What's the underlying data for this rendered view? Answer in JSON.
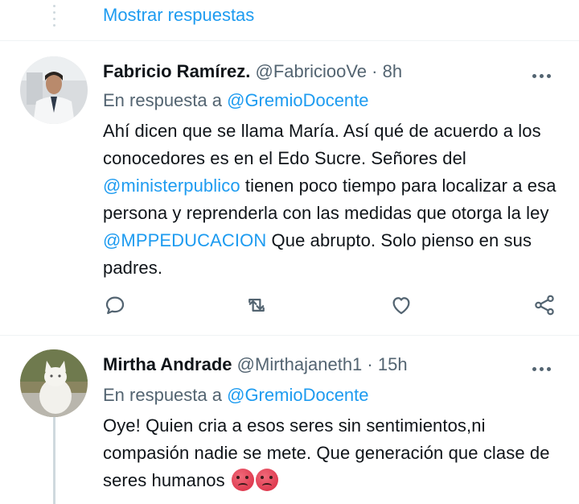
{
  "show_replies": {
    "label": "Mostrar respuestas"
  },
  "tweets": [
    {
      "name": "Fabricio Ramírez.",
      "handle": "@FabricioоVe",
      "separator": "·",
      "time": "8h",
      "reply_prefix": "En respuesta a",
      "reply_mention": "@GremioDocente",
      "body": [
        {
          "t": "Ahí dicen que se llama María. Así qué de acuerdo a los conocedores es en el Edo Sucre. Señores del "
        },
        {
          "t": "@ministerpublico",
          "mention": true
        },
        {
          "t": " tienen poco tiempo para localizar a esa persona y reprenderla con las medidas que otorga la ley "
        },
        {
          "t": "@MPPEDUCACION",
          "mention": true
        },
        {
          "t": " Que abrupto. Solo pienso en sus padres."
        }
      ],
      "icons": [
        "reply-icon",
        "retweet-icon",
        "like-icon",
        "share-icon"
      ]
    },
    {
      "name": "Mirtha Andrade",
      "handle": "@Mirthajaneth1",
      "separator": "·",
      "time": "15h",
      "reply_prefix": "En respuesta a",
      "reply_mention": "@GremioDocente",
      "body": [
        {
          "t": "Oye! Quien cria a esos seres sin sentimientos,ni compasión nadie se mete. Que generación que clase de seres humanos"
        }
      ],
      "emoji": [
        "angry-face-emoji",
        "angry-face-emoji"
      ]
    }
  ],
  "colors": {
    "accent": "#1d9bf0",
    "text": "#0f1419",
    "muted": "#536471",
    "line": "#cfd9de"
  }
}
